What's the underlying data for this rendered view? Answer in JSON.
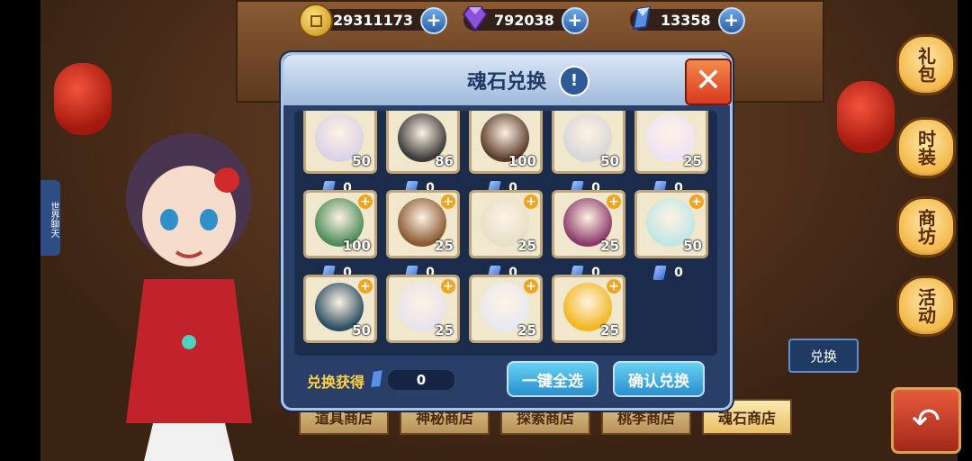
{
  "currency": {
    "gold": "29311173",
    "gems": "792038",
    "soulstones": "13358"
  },
  "modal": {
    "title": "魂石兑换",
    "footer_label": "兑换获得",
    "footer_value": "0",
    "btn_select_all": "一键全选",
    "btn_confirm": "确认兑换"
  },
  "heroes": [
    {
      "level": "50",
      "soul": "0",
      "color": "#d9d3e6"
    },
    {
      "level": "86",
      "soul": "0",
      "color": "#3a3a3a"
    },
    {
      "level": "100",
      "soul": "0",
      "color": "#5b3b2a"
    },
    {
      "level": "50",
      "soul": "0",
      "color": "#d7d7d7"
    },
    {
      "level": "25",
      "soul": "0",
      "color": "#eee3f5"
    },
    {
      "level": "100",
      "soul": "0",
      "color": "#4c8d5a"
    },
    {
      "level": "25",
      "soul": "0",
      "color": "#8a5a32"
    },
    {
      "level": "25",
      "soul": "0",
      "color": "#e6e0c8"
    },
    {
      "level": "25",
      "soul": "0",
      "color": "#8a3a6a"
    },
    {
      "level": "50",
      "soul": "0",
      "color": "#bfe7e6"
    },
    {
      "level": "50",
      "soul": "",
      "color": "#2b4e62"
    },
    {
      "level": "25",
      "soul": "",
      "color": "#e7e3ee"
    },
    {
      "level": "25",
      "soul": "",
      "color": "#e9e9f2"
    },
    {
      "level": "25",
      "soul": "",
      "color": "#f1b71e"
    }
  ],
  "right_menu": [
    "礼包",
    "时装",
    "商坊",
    "活动"
  ],
  "swap_label": "兑换",
  "shop_tabs": [
    "道具商店",
    "神秘商店",
    "探索商店",
    "桃李商店",
    "魂石商店"
  ],
  "side_badge": "世界聊天"
}
